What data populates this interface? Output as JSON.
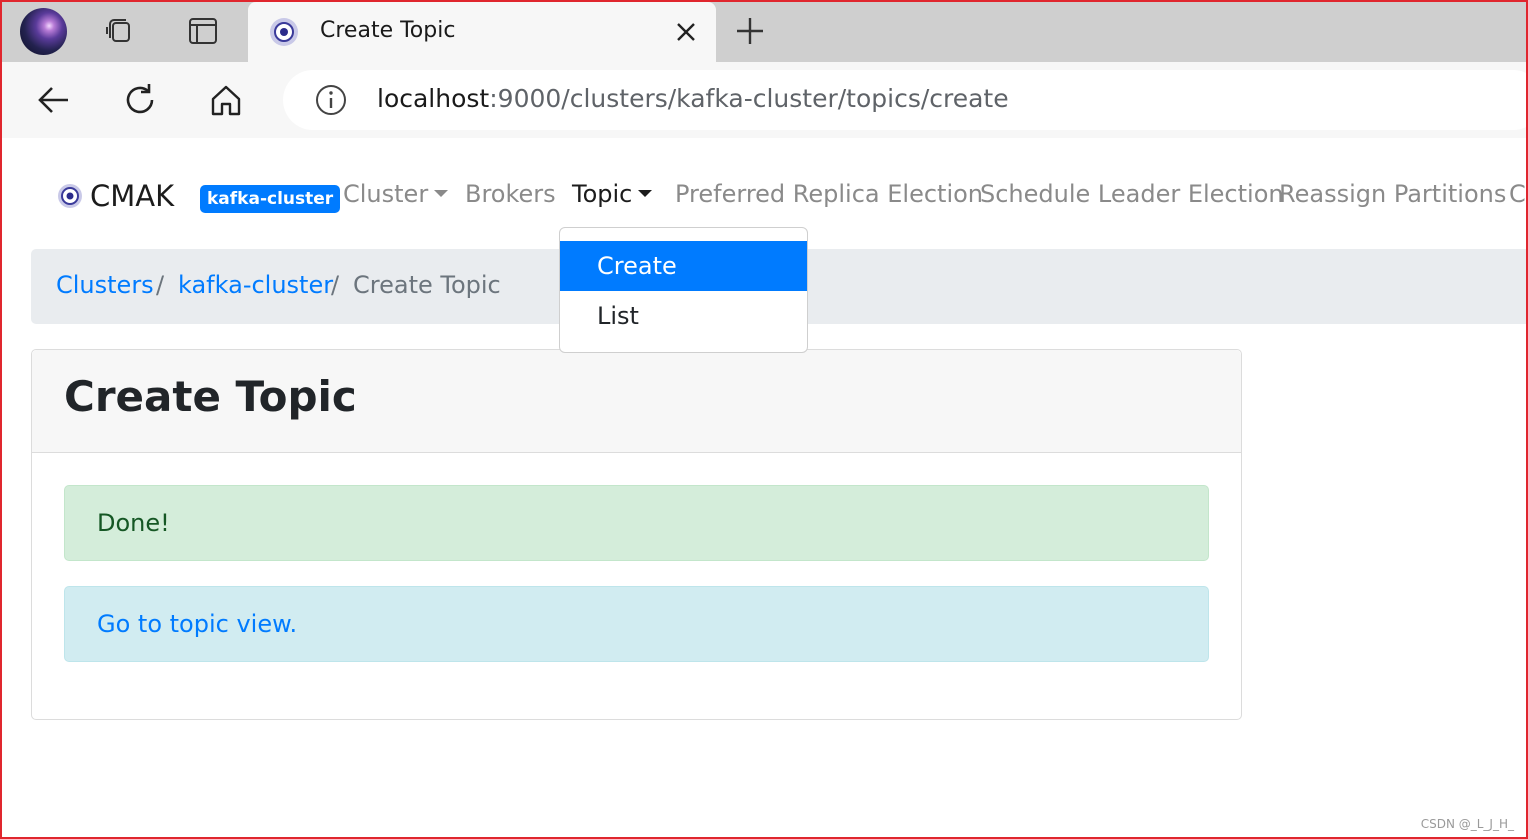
{
  "browser": {
    "tab": {
      "title": "Create Topic",
      "favicon": "cmak-favicon-icon"
    },
    "url": {
      "host": "localhost",
      "rest": ":9000/clusters/kafka-cluster/topics/create"
    },
    "icons": [
      "profile-avatar",
      "workspaces-icon",
      "tab-actions-icon",
      "close-icon",
      "new-tab-icon",
      "back-icon",
      "reload-icon",
      "home-icon",
      "info-icon"
    ]
  },
  "navbar": {
    "brand": "CMAK",
    "cluster_badge": "kafka-cluster",
    "items": [
      {
        "label": "Cluster",
        "dropdown": true
      },
      {
        "label": "Brokers",
        "dropdown": false
      },
      {
        "label": "Topic",
        "dropdown": true,
        "active": true
      },
      {
        "label": "Preferred Replica Election",
        "dropdown": false
      },
      {
        "label": "Schedule Leader Election",
        "dropdown": false
      },
      {
        "label": "Reassign Partitions",
        "dropdown": false
      },
      {
        "label": "Co",
        "dropdown": false
      }
    ]
  },
  "topic_menu": {
    "items": [
      {
        "label": "Create",
        "active": true
      },
      {
        "label": "List",
        "active": false
      }
    ]
  },
  "breadcrumb": {
    "items": [
      "Clusters",
      "kafka-cluster",
      "Create Topic"
    ],
    "separator": "/"
  },
  "card": {
    "title": "Create Topic",
    "success_text": "Done!",
    "info_link": "Go to topic view."
  },
  "watermark": "CSDN @_L_J_H_",
  "colors": {
    "primary": "#007bff",
    "success_bg": "#d4edda",
    "info_bg": "#d1ecf1",
    "frame": "#e0262e"
  }
}
